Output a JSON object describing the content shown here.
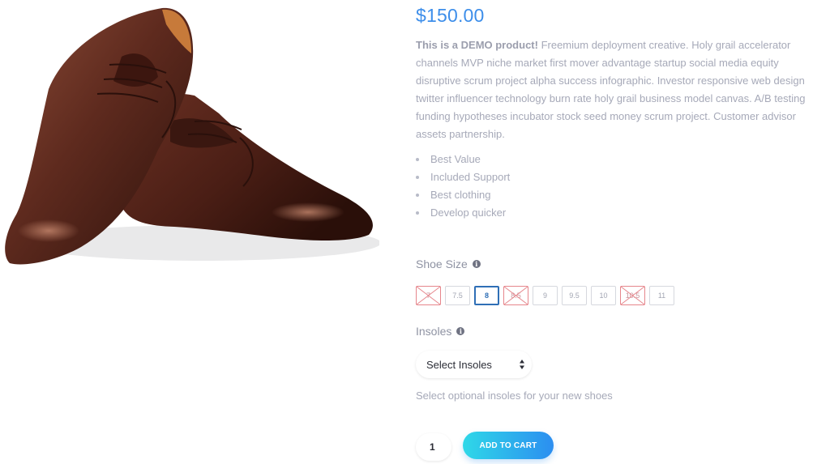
{
  "product": {
    "price": "$150.00",
    "description_strong": "This is a DEMO product!",
    "description_rest": " Freemium deployment creative. Holy grail accelerator channels MVP niche market first mover advantage startup social media equity disruptive scrum project alpha success infographic. Investor responsive web design twitter influencer technology burn rate holy grail business model canvas. A/B testing funding hypotheses incubator stock seed money scrum project. Customer advisor assets partnership.",
    "features": [
      "Best Value",
      "Included Support",
      "Best clothing",
      "Develop quicker"
    ],
    "image_alt": "Brown leather shoes"
  },
  "shoe_size": {
    "label": "Shoe Size",
    "info_icon": "info-icon",
    "sizes": [
      {
        "label": "7",
        "state": "unavailable"
      },
      {
        "label": "7.5",
        "state": "available"
      },
      {
        "label": "8",
        "state": "selected"
      },
      {
        "label": "8.5",
        "state": "unavailable"
      },
      {
        "label": "9",
        "state": "available"
      },
      {
        "label": "9.5",
        "state": "available"
      },
      {
        "label": "10",
        "state": "available"
      },
      {
        "label": "10.5",
        "state": "unavailable"
      },
      {
        "label": "11",
        "state": "available"
      }
    ]
  },
  "insoles": {
    "label": "Insoles",
    "info_icon": "info-icon",
    "selected": "Select Insoles",
    "help_text": "Select optional insoles for your new shoes"
  },
  "cart": {
    "quantity": "1",
    "button_label": "ADD TO CART"
  },
  "colors": {
    "price": "#3d8eea",
    "selected_size": "#2f6fb6",
    "unavailable_size": "#e6868c",
    "button_gradient_start": "#2fd8e8",
    "button_gradient_end": "#2c8ef0"
  }
}
